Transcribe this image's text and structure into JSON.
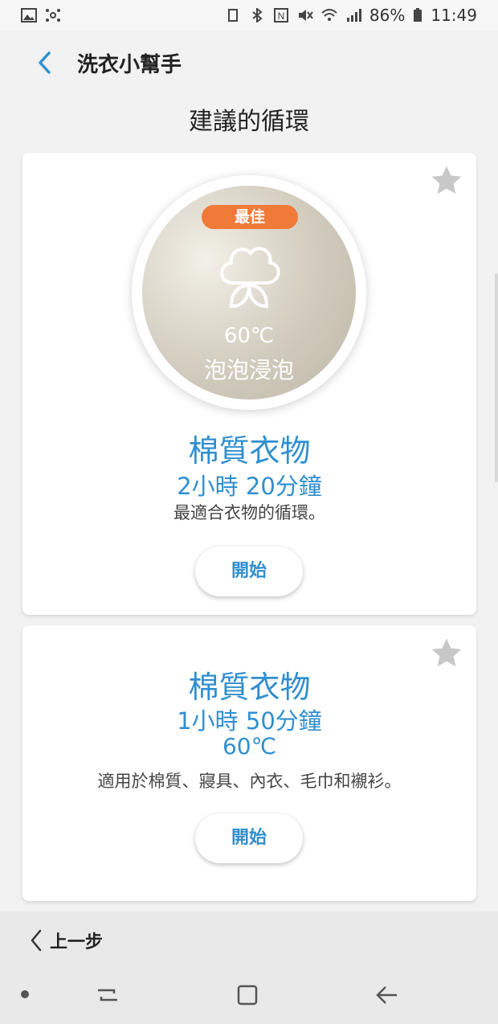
{
  "status_bar": {
    "battery": "86%",
    "time": "11:49"
  },
  "app_bar": {
    "title": "洗衣小幫手"
  },
  "section_title": "建議的循環",
  "cards": [
    {
      "badge": "最佳",
      "circle_temp": "60℃",
      "circle_mode": "泡泡浸泡",
      "name": "棉質衣物",
      "duration": "2小時 20分鐘",
      "description": "最適合衣物的循環。",
      "start_label": "開始"
    },
    {
      "name": "棉質衣物",
      "duration": "1小時 50分鐘",
      "temperature": "60℃",
      "description": "適用於棉質、寢具、內衣、毛巾和襯衫。",
      "start_label": "開始"
    }
  ],
  "bottom": {
    "prev_label": "上一步"
  },
  "colors": {
    "accent": "#2f8fd0",
    "badge": "#f07a38",
    "star": "#c8c8c8"
  }
}
